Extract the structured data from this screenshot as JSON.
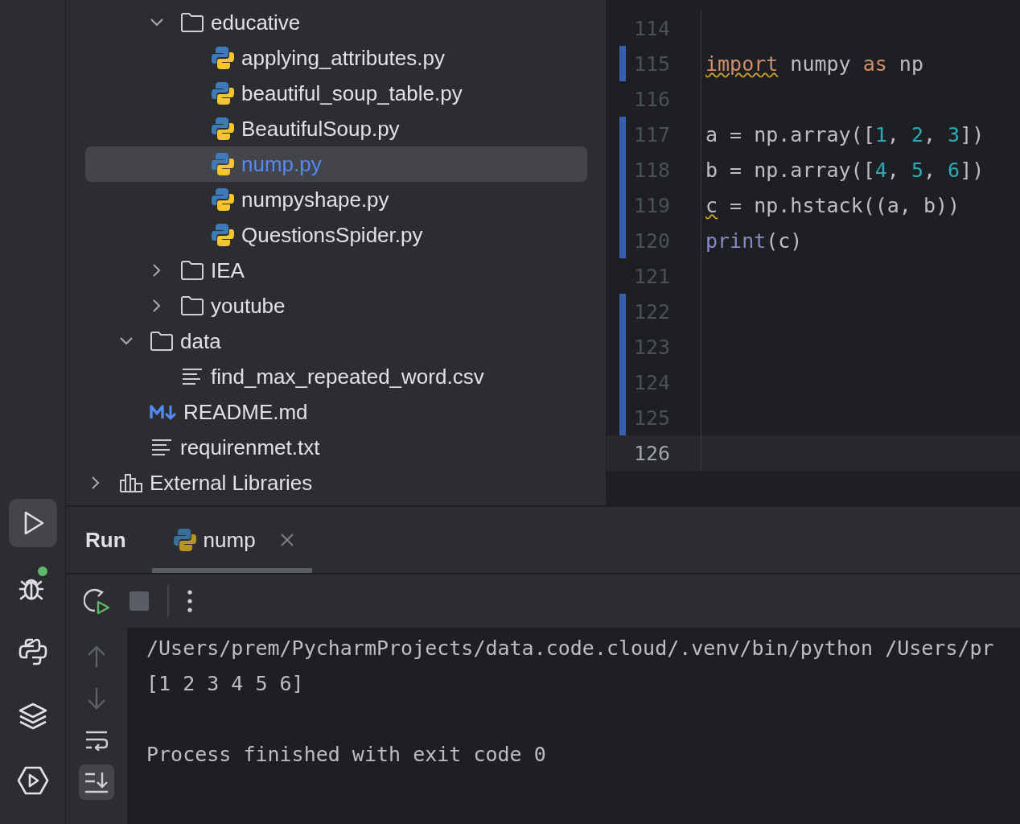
{
  "sidebar": {
    "tools": [
      {
        "kind": "run",
        "selected": true
      },
      {
        "kind": "debug",
        "selected": false,
        "notification": true
      },
      {
        "kind": "python",
        "selected": false
      },
      {
        "kind": "layers",
        "selected": false
      },
      {
        "kind": "services",
        "selected": false
      }
    ]
  },
  "project_tree": {
    "items": [
      {
        "children": [
          {
            "children": [
              {
                "kind": "folder",
                "label": "educative",
                "expanded": true,
                "selected": false,
                "children": [
                  {
                    "kind": "python",
                    "label": "applying_attributes.py",
                    "selected": false
                  },
                  {
                    "kind": "python",
                    "label": "beautiful_soup_table.py",
                    "selected": false
                  },
                  {
                    "kind": "python",
                    "label": "BeautifulSoup.py",
                    "selected": false
                  },
                  {
                    "kind": "python",
                    "label": "nump.py",
                    "selected": true
                  },
                  {
                    "kind": "python",
                    "label": "numpyshape.py",
                    "selected": false
                  },
                  {
                    "kind": "python",
                    "label": "QuestionsSpider.py",
                    "selected": false
                  }
                ]
              },
              {
                "kind": "folder",
                "label": "IEA",
                "expanded": false,
                "selected": false
              },
              {
                "kind": "folder",
                "label": "youtube",
                "expanded": false,
                "selected": false
              }
            ]
          },
          {
            "kind": "folder",
            "label": "data",
            "expanded": true,
            "selected": false,
            "children": [
              {
                "kind": "text",
                "label": "find_max_repeated_word.csv",
                "selected": false
              }
            ]
          },
          {
            "kind": "markdown",
            "label": "README.md",
            "selected": false
          },
          {
            "kind": "text",
            "label": "requirenmet.txt",
            "selected": false
          }
        ]
      },
      {
        "kind": "library",
        "label": "External Libraries",
        "expanded": false,
        "selected": false
      }
    ]
  },
  "editor": {
    "lines": [
      {
        "number": "114",
        "changed": false,
        "current": false
      },
      {
        "number": "115",
        "changed": true,
        "current": false,
        "tokens": [
          {
            "text": "import",
            "kind": "keyword",
            "warning": true
          },
          {
            "text": " numpy ",
            "kind": "plain"
          },
          {
            "text": "as",
            "kind": "keyword"
          },
          {
            "text": " np",
            "kind": "plain"
          }
        ]
      },
      {
        "number": "116",
        "changed": false,
        "current": false
      },
      {
        "number": "117",
        "changed": true,
        "current": false,
        "tokens": [
          {
            "text": "a = np.array([",
            "kind": "plain"
          },
          {
            "text": "1",
            "kind": "number"
          },
          {
            "text": ", ",
            "kind": "plain"
          },
          {
            "text": "2",
            "kind": "number"
          },
          {
            "text": ", ",
            "kind": "plain"
          },
          {
            "text": "3",
            "kind": "number"
          },
          {
            "text": "])",
            "kind": "plain"
          }
        ]
      },
      {
        "number": "118",
        "changed": true,
        "current": false,
        "tokens": [
          {
            "text": "b = np.array([",
            "kind": "plain"
          },
          {
            "text": "4",
            "kind": "number"
          },
          {
            "text": ", ",
            "kind": "plain"
          },
          {
            "text": "5",
            "kind": "number"
          },
          {
            "text": ", ",
            "kind": "plain"
          },
          {
            "text": "6",
            "kind": "number"
          },
          {
            "text": "])",
            "kind": "plain"
          }
        ]
      },
      {
        "number": "119",
        "changed": true,
        "current": false,
        "tokens": [
          {
            "text": "c",
            "kind": "plain",
            "warning": true
          },
          {
            "text": " = np.hstack((a, b))",
            "kind": "plain"
          }
        ]
      },
      {
        "number": "120",
        "changed": true,
        "current": false,
        "tokens": [
          {
            "text": "print",
            "kind": "builtin"
          },
          {
            "text": "(c)",
            "kind": "plain"
          }
        ]
      },
      {
        "number": "121",
        "changed": false,
        "current": false
      },
      {
        "number": "122",
        "changed": true,
        "current": false
      },
      {
        "number": "123",
        "changed": true,
        "current": false
      },
      {
        "number": "124",
        "changed": true,
        "current": false
      },
      {
        "number": "125",
        "changed": true,
        "current": false
      },
      {
        "number": "126",
        "changed": false,
        "current": true
      }
    ]
  },
  "run_panel": {
    "title": "Run",
    "tabs": [
      {
        "label": "nump",
        "selected": true
      }
    ],
    "toolbar": [
      {
        "kind": "rerun"
      },
      {
        "kind": "stop"
      },
      {
        "kind": "divider"
      },
      {
        "kind": "more"
      }
    ],
    "side_tools": [
      {
        "kind": "up",
        "selected": false
      },
      {
        "kind": "down",
        "selected": false
      },
      {
        "kind": "wrap",
        "selected": false
      },
      {
        "kind": "scroll-end",
        "selected": true
      }
    ],
    "console": {
      "lines": [
        "/Users/prem/PycharmProjects/data.code.cloud/.venv/bin/python /Users/pr",
        "[1 2 3 4 5 6]"
      ],
      "exit_message": "Process finished with exit code 0"
    }
  }
}
